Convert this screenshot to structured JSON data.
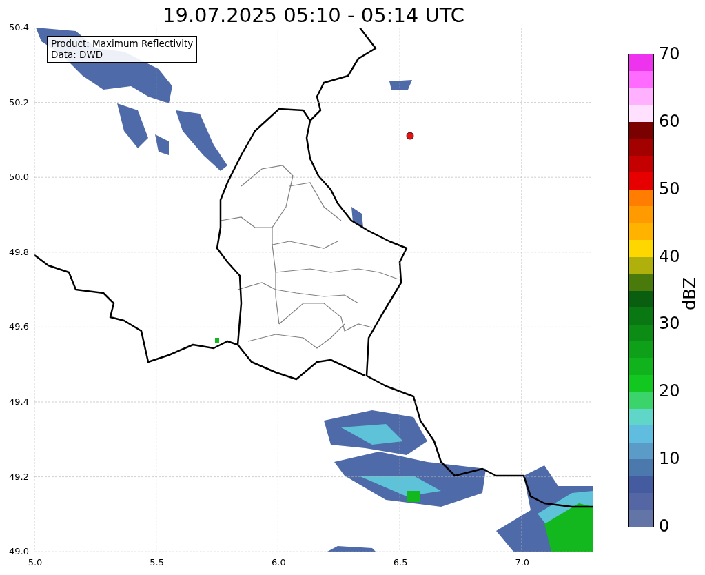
{
  "title": "19.07.2025 05:10 - 05:14 UTC",
  "annotation": [
    "Product: Maximum Reflectivity",
    "Data: DWD"
  ],
  "x_ticks": [
    "5.0",
    "5.5",
    "6.0",
    "6.5",
    "7.0"
  ],
  "y_ticks": [
    "50.4",
    "50.2",
    "50.0",
    "49.8",
    "49.6",
    "49.4",
    "49.2",
    "49.0"
  ],
  "colorbar": {
    "label": "dBZ",
    "ticks": [
      "70",
      "60",
      "50",
      "40",
      "30",
      "20",
      "10",
      "0"
    ],
    "bins": [
      {
        "color": "#6374a6"
      },
      {
        "color": "#5566a4"
      },
      {
        "color": "#445c9f"
      },
      {
        "color": "#4b79ad"
      },
      {
        "color": "#5a9bc8"
      },
      {
        "color": "#60bde0"
      },
      {
        "color": "#60d6c8"
      },
      {
        "color": "#3bd46a"
      },
      {
        "color": "#12c820"
      },
      {
        "color": "#10b31c"
      },
      {
        "color": "#0ea018"
      },
      {
        "color": "#0c8c14"
      },
      {
        "color": "#0a7812"
      },
      {
        "color": "#095e10"
      },
      {
        "color": "#4a7a0c"
      },
      {
        "color": "#b0b00c"
      },
      {
        "color": "#ffd700"
      },
      {
        "color": "#ffb300"
      },
      {
        "color": "#ff9a00"
      },
      {
        "color": "#ff7d00"
      },
      {
        "color": "#e60000"
      },
      {
        "color": "#c40000"
      },
      {
        "color": "#a30000"
      },
      {
        "color": "#7b0000"
      },
      {
        "color": "#ffe0ff"
      },
      {
        "color": "#ffb0ff"
      },
      {
        "color": "#ff6bff"
      },
      {
        "color": "#ee33ee"
      }
    ]
  }
}
